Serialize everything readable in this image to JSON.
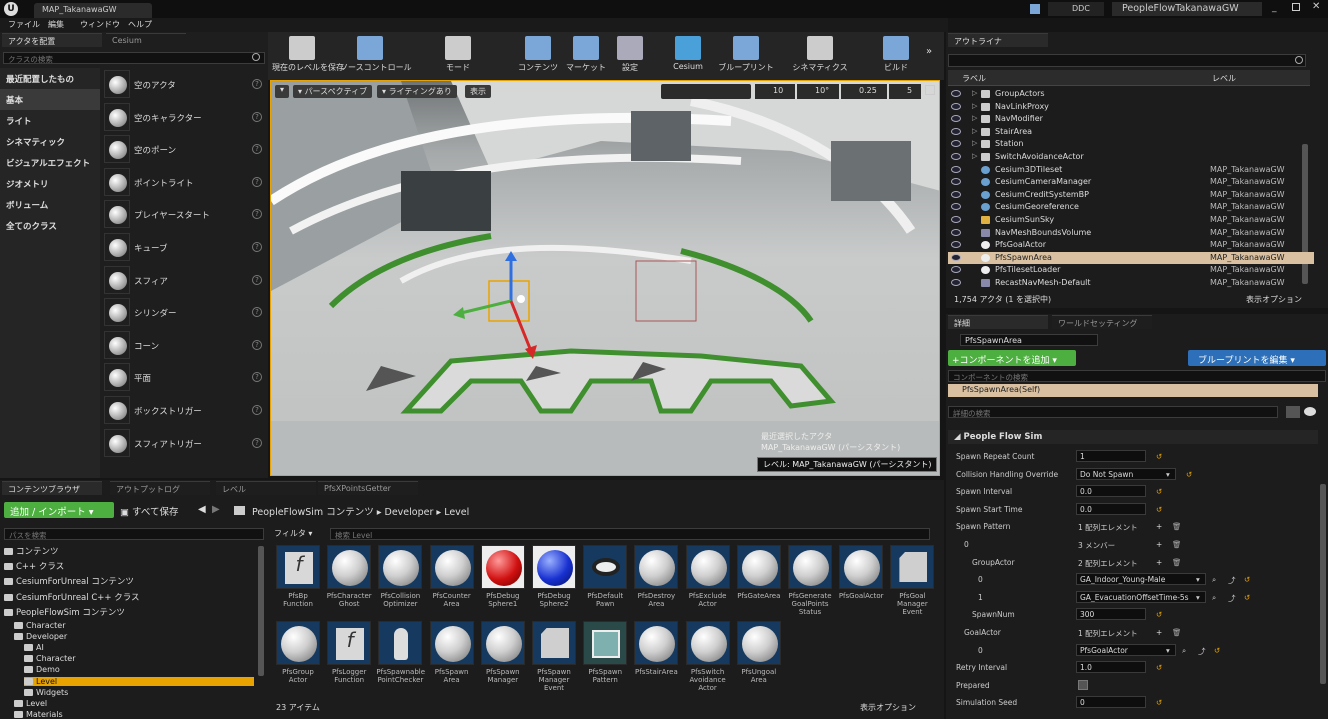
{
  "window": {
    "tab": "MAP_TakanawaGW",
    "ddc": "DDC",
    "project": "PeopleFlowTakanawaGW"
  },
  "menu": [
    "ファイル",
    "編集",
    "ウィンドウ",
    "ヘルプ"
  ],
  "place": {
    "tab": "アクタを配置",
    "tab2": "Cesium",
    "search_placeholder": "クラスの検索",
    "categories": [
      "最近配置したもの",
      "基本",
      "ライト",
      "シネマティック",
      "ビジュアルエフェクト",
      "ジオメトリ",
      "ボリューム",
      "全てのクラス"
    ],
    "items": [
      "空のアクタ",
      "空のキャラクター",
      "空のポーン",
      "ポイントライト",
      "プレイヤースタート",
      "キューブ",
      "スフィア",
      "シリンダー",
      "コーン",
      "平面",
      "ボックストリガー",
      "スフィアトリガー"
    ]
  },
  "toolbar": [
    "現在のレベルを保存",
    "ソースコントロール",
    "モード",
    "コンテンツ",
    "マーケット",
    "設定",
    "Cesium",
    "ブループリント",
    "シネマティクス",
    "ビルド"
  ],
  "viewport": {
    "perspective": "パースペクティブ",
    "lighting": "ライティングあり",
    "show": "表示",
    "snap_grid": "10",
    "snap_rot": "10°",
    "snap_scale": "0.25",
    "cam_speed": "5",
    "overlay1": "最近選択したアクタ",
    "overlay2": "MAP_TakanawaGW (パーシスタント)",
    "level_label": "レベル: MAP_TakanawaGW (パーシスタント)"
  },
  "outliner": {
    "tab": "アウトライナ",
    "col_label": "ラベル",
    "col_level": "レベル",
    "count": "1,754 アクタ (1 を選択中)",
    "view_options": "表示オプション",
    "rows": [
      {
        "name": "GroupActors",
        "level": "",
        "type": "folder"
      },
      {
        "name": "NavLinkProxy",
        "level": "",
        "type": "folder"
      },
      {
        "name": "NavModifier",
        "level": "",
        "type": "folder"
      },
      {
        "name": "StairArea",
        "level": "",
        "type": "folder"
      },
      {
        "name": "Station",
        "level": "",
        "type": "folder"
      },
      {
        "name": "SwitchAvoidanceActor",
        "level": "",
        "type": "folder"
      },
      {
        "name": "Cesium3DTileset",
        "level": "MAP_TakanawaGW",
        "type": "globe"
      },
      {
        "name": "CesiumCameraManager",
        "level": "MAP_TakanawaGW",
        "type": "globe"
      },
      {
        "name": "CesiumCreditSystemBP",
        "level": "MAP_TakanawaGW",
        "type": "globe"
      },
      {
        "name": "CesiumGeoreference",
        "level": "MAP_TakanawaGW",
        "type": "globe"
      },
      {
        "name": "CesiumSunSky",
        "level": "MAP_TakanawaGW",
        "type": "sun"
      },
      {
        "name": "NavMeshBoundsVolume",
        "level": "MAP_TakanawaGW",
        "type": "box"
      },
      {
        "name": "PfsGoalActor",
        "level": "MAP_TakanawaGW",
        "type": "ball"
      },
      {
        "name": "PfsSpawnArea",
        "level": "MAP_TakanawaGW",
        "type": "ball",
        "selected": true
      },
      {
        "name": "PfsTilesetLoader",
        "level": "MAP_TakanawaGW",
        "type": "ball"
      },
      {
        "name": "RecastNavMesh-Default",
        "level": "MAP_TakanawaGW",
        "type": "box"
      }
    ]
  },
  "details": {
    "tab": "詳細",
    "tab2": "ワールドセッティング",
    "name": "PfsSpawnArea",
    "add_component": "+コンポーネントを追加 ▾",
    "edit_bp": "ブループリントを編集 ▾",
    "comp_search": "コンポーネントの検索",
    "self": "PfsSpawnArea(Self)",
    "search": "詳細の検索",
    "section": "People Flow Sim",
    "props": [
      {
        "k": "Spawn Repeat Count",
        "v": "1",
        "x": 8
      },
      {
        "k": "Collision Handling Override",
        "v": "Do Not Spawn",
        "x": 8,
        "dd": true
      },
      {
        "k": "Spawn Interval",
        "v": "0.0",
        "x": 8
      },
      {
        "k": "Spawn Start Time",
        "v": "0.0",
        "x": 8
      },
      {
        "k": "Spawn Pattern",
        "v": "1 配列エレメント",
        "x": 8,
        "plain": true
      },
      {
        "k": "0",
        "v": "3 メンバー",
        "x": 16,
        "plain": true
      },
      {
        "k": "GroupActor",
        "v": "2 配列エレメント",
        "x": 24,
        "plain": true
      },
      {
        "k": "0",
        "v": "GA_Indoor_Young-Male",
        "x": 30,
        "dd": true
      },
      {
        "k": "1",
        "v": "GA_EvacuationOffsetTime-5s",
        "x": 30,
        "dd": true
      },
      {
        "k": "SpawnNum",
        "v": "300",
        "x": 24
      },
      {
        "k": "GoalActor",
        "v": "1 配列エレメント",
        "x": 16,
        "plain": true
      },
      {
        "k": "0",
        "v": "PfsGoalActor",
        "x": 30,
        "dd": true
      },
      {
        "k": "Retry Interval",
        "v": "1.0",
        "x": 8
      },
      {
        "k": "Prepared",
        "v": "",
        "x": 8,
        "check": true
      },
      {
        "k": "Simulation Seed",
        "v": "0",
        "x": 8
      }
    ]
  },
  "content": {
    "tabs": [
      "コンテンツブラウザ",
      "アウトプットログ",
      "レベル",
      "PfsXPointsGetter"
    ],
    "add_import": "追加 / インポート ▾",
    "save_all": "すべて保存",
    "crumbs": [
      "PeopleFlowSim コンテンツ",
      "Developer",
      "Level"
    ],
    "path_search": "パスを検索",
    "filter": "フィルタ ▾",
    "asset_search": "検索 Level",
    "count": "23 アイテム",
    "view_options": "表示オプション",
    "tree": [
      {
        "t": "コンテンツ",
        "d": 0
      },
      {
        "t": "C++ クラス",
        "d": 0
      },
      {
        "t": "CesiumForUnreal コンテンツ",
        "d": 0
      },
      {
        "t": "CesiumForUnreal C++ クラス",
        "d": 0
      },
      {
        "t": "PeopleFlowSim コンテンツ",
        "d": 0
      },
      {
        "t": "Character",
        "d": 1
      },
      {
        "t": "Developer",
        "d": 1
      },
      {
        "t": "AI",
        "d": 2
      },
      {
        "t": "Character",
        "d": 2
      },
      {
        "t": "Demo",
        "d": 2
      },
      {
        "t": "Level",
        "d": 2,
        "sel": true
      },
      {
        "t": "Widgets",
        "d": 2
      },
      {
        "t": "Level",
        "d": 1
      },
      {
        "t": "Materials",
        "d": 1
      }
    ],
    "assets": [
      {
        "n": "PfsBp Function",
        "k": "func"
      },
      {
        "n": "PfsCharacter Ghost",
        "k": "ball"
      },
      {
        "n": "PfsCollision Optimizer",
        "k": "ball"
      },
      {
        "n": "PfsCounter Area",
        "k": "ball"
      },
      {
        "n": "PfsDebug Sphere1",
        "k": "red"
      },
      {
        "n": "PfsDebug Sphere2",
        "k": "blue"
      },
      {
        "n": "PfsDefault Pawn",
        "k": "eye"
      },
      {
        "n": "PfsDestroy Area",
        "k": "ball"
      },
      {
        "n": "PfsExclude Actor",
        "k": "ball"
      },
      {
        "n": "PfsGateArea",
        "k": "ball"
      },
      {
        "n": "PfsGenerate GoalPoints Status",
        "k": "ball"
      },
      {
        "n": "PfsGoalActor",
        "k": "ball"
      },
      {
        "n": "PfsGoal Manager Event",
        "k": "mgr"
      },
      {
        "n": "PfsGroup Actor",
        "k": "ball"
      },
      {
        "n": "PfsLogger Function",
        "k": "func"
      },
      {
        "n": "PfsSpawnable PointChecker",
        "k": "pawn"
      },
      {
        "n": "PfsSpawn Area",
        "k": "ball"
      },
      {
        "n": "PfsSpawn Manager",
        "k": "ball"
      },
      {
        "n": "PfsSpawn Manager Event",
        "k": "mgr"
      },
      {
        "n": "PfsSpawn Pattern",
        "k": "pat"
      },
      {
        "n": "PfsStairArea",
        "k": "ball"
      },
      {
        "n": "PfsSwitch Avoidance Actor",
        "k": "ball"
      },
      {
        "n": "PfsUngoal Area",
        "k": "ball"
      }
    ]
  },
  "colors": {
    "accent_green": "#4caf3f",
    "accent_blue": "#2d6fb8",
    "select": "#d9c0a0",
    "level_sel": "#e8a300"
  }
}
